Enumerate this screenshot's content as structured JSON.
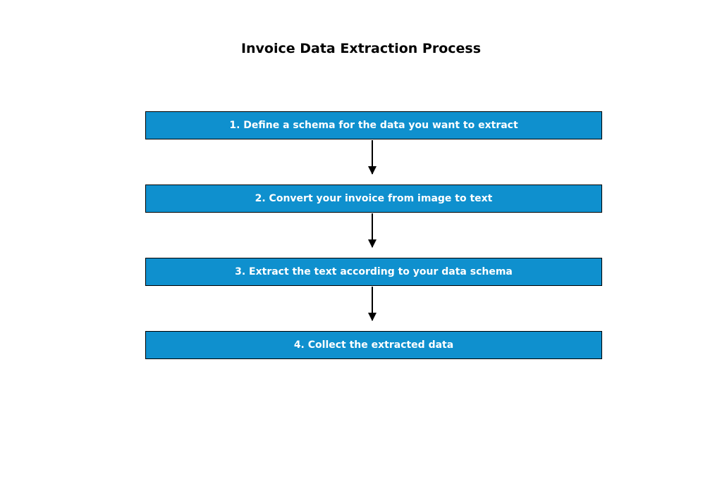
{
  "chart_data": {
    "type": "flowchart",
    "title": "Invoice Data Extraction Process",
    "direction": "top-to-bottom",
    "nodes": [
      {
        "id": "step1",
        "order": 1,
        "label": "1. Define a schema for the data you want to extract"
      },
      {
        "id": "step2",
        "order": 2,
        "label": "2. Convert your invoice from image to text"
      },
      {
        "id": "step3",
        "order": 3,
        "label": "3. Extract the text according to your data schema"
      },
      {
        "id": "step4",
        "order": 4,
        "label": "4. Collect the extracted data"
      }
    ],
    "edges": [
      {
        "from": "step1",
        "to": "step2"
      },
      {
        "from": "step2",
        "to": "step3"
      },
      {
        "from": "step3",
        "to": "step4"
      }
    ],
    "style": {
      "node_fill": "#0f90ce",
      "node_text_color": "#ffffff",
      "node_border": "#000000",
      "arrow_color": "#000000",
      "background": "#ffffff"
    }
  }
}
